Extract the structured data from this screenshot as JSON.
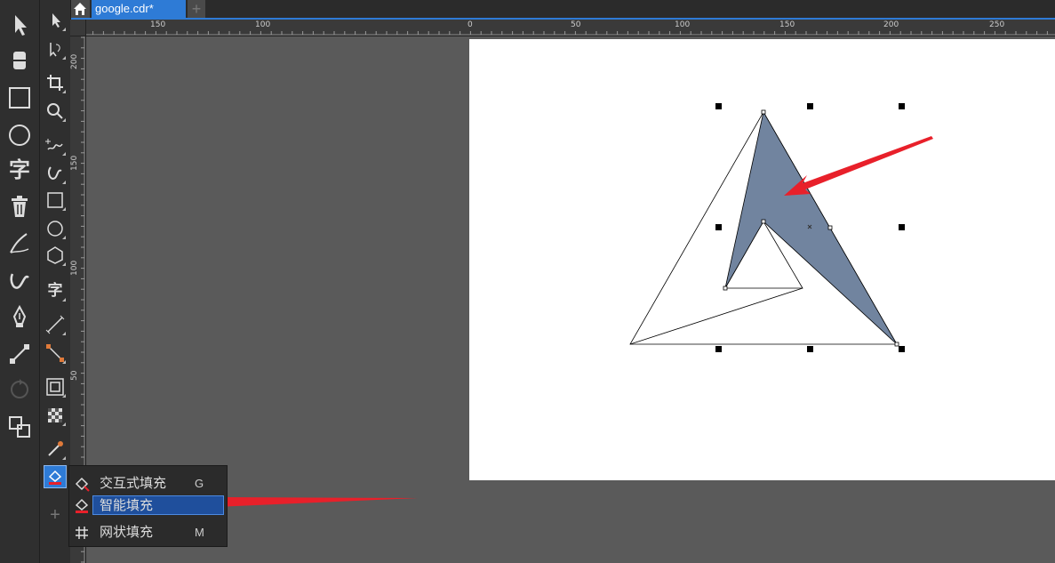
{
  "tabs": {
    "document_title": "google.cdr*",
    "add_label": "+"
  },
  "ruler": {
    "h_labels": [
      "150",
      "100",
      "0",
      "50",
      "100",
      "150",
      "200",
      "250"
    ],
    "v_labels": [
      "200",
      "150",
      "100",
      "50"
    ]
  },
  "flyout": {
    "items": [
      {
        "label": "交互式填充",
        "shortcut": "G",
        "icon": "interactive-fill-icon"
      },
      {
        "label": "智能填充",
        "shortcut": "",
        "icon": "smart-fill-icon"
      },
      {
        "label": "网状填充",
        "shortcut": "M",
        "icon": "mesh-fill-icon"
      }
    ]
  },
  "left_toolbar": {
    "text_tool_glyph": "字"
  },
  "tools_panel": {
    "text_tool_glyph": "字",
    "add_label": "+"
  },
  "colors": {
    "accent": "#2e7bd6",
    "shape_fill": "#71849f",
    "arrow": "#e8202a"
  }
}
